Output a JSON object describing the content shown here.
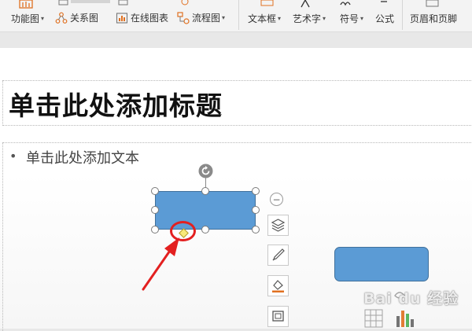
{
  "ribbon": {
    "items": [
      {
        "label": "功能图",
        "icon": "function-chart-icon",
        "dropdown": true
      },
      {
        "label": "关系图",
        "icon": "relation-chart-icon",
        "dropdown": false
      },
      {
        "label": "在线图表",
        "icon": "online-chart-icon",
        "dropdown": false
      },
      {
        "label": "流程图",
        "icon": "flowchart-icon",
        "dropdown": true
      },
      {
        "label": "文本框",
        "icon": "textbox-icon",
        "dropdown": true
      },
      {
        "label": "艺术字",
        "icon": "wordart-icon",
        "dropdown": true
      },
      {
        "label": "符号",
        "icon": "symbol-icon",
        "dropdown": true
      },
      {
        "label": "公式",
        "icon": "formula-icon",
        "dropdown": false
      },
      {
        "label": "页眉和页脚",
        "icon": "header-footer-icon",
        "dropdown": false
      }
    ]
  },
  "slide": {
    "title_placeholder": "单击此处添加标题",
    "body_bullet": "•",
    "body_placeholder": "单击此处添加文本"
  },
  "float_toolbar": {
    "collapse_symbol": "−",
    "buttons": [
      "layers-icon",
      "pen-icon",
      "fill-icon",
      "outline-icon"
    ]
  },
  "watermark": {
    "text": "Bai du 经验"
  },
  "colors": {
    "shape_fill": "#5b9bd5",
    "shape_border": "#41719c",
    "highlight_red": "#e32020",
    "adjust_handle": "#f7e97a",
    "accent_orange": "#e07020"
  }
}
